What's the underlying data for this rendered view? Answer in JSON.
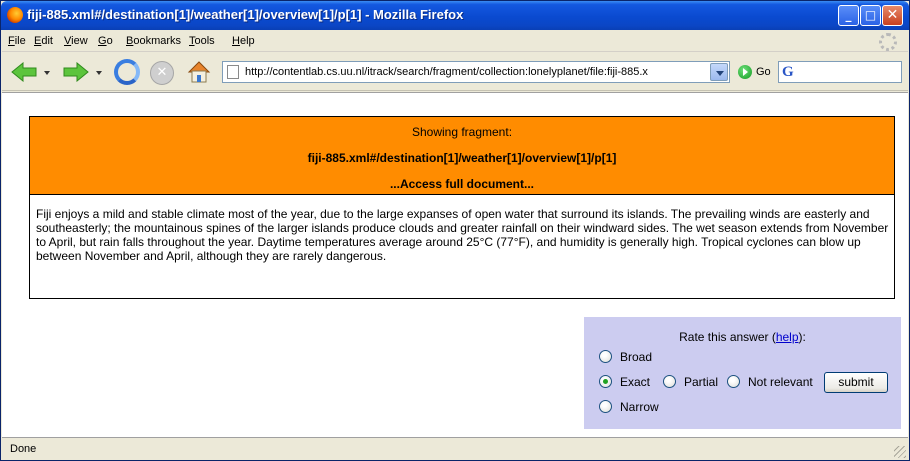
{
  "window": {
    "title": "fiji-885.xml#/destination[1]/weather[1]/overview[1]/p[1] - Mozilla Firefox",
    "controls": {
      "minimize": "_",
      "maximize": "□",
      "close": "✕"
    }
  },
  "menu": {
    "file": {
      "u": "F",
      "rest": "ile"
    },
    "edit": {
      "u": "E",
      "rest": "dit"
    },
    "view": {
      "u": "V",
      "rest": "iew"
    },
    "go": {
      "u": "G",
      "rest": "o"
    },
    "bookmarks": {
      "u": "B",
      "rest": "ookmarks"
    },
    "tools": {
      "u": "T",
      "rest": "ools"
    },
    "help": {
      "u": "H",
      "rest": "elp"
    }
  },
  "toolbar": {
    "url": "http://contentlab.cs.uu.nl/itrack/search/fragment/collection:lonelyplanet/file:fiji-885.x",
    "go_label": "Go",
    "search_logo": "G",
    "stop_symbol": "✕"
  },
  "fragment": {
    "showing_label": "Showing fragment:",
    "id": "fiji-885.xml#/destination[1]/weather[1]/overview[1]/p[1]",
    "access_link": "...Access full document...",
    "text": "Fiji enjoys a mild and stable climate most of the year, due to the large expanses of open water that surround its islands. The prevailing winds are easterly and southeasterly; the mountainous spines of the larger islands produce clouds and greater rainfall on their windward sides. The wet season extends from November to April, but rain falls throughout the year. Daytime temperatures average around 25°C (77°F), and humidity is generally high. Tropical cyclones can blow up between November and April, although they are rarely dangerous."
  },
  "rating": {
    "title_prefix": "Rate this answer (",
    "help_link": "help",
    "title_suffix": "):",
    "options": {
      "broad": "Broad",
      "exact": "Exact",
      "partial": "Partial",
      "not_relevant": "Not relevant",
      "narrow": "Narrow"
    },
    "selected": "Exact",
    "submit_label": "submit"
  },
  "status": {
    "text": "Done"
  },
  "colors": {
    "fragment_header_bg": "#ff8c00",
    "rating_panel_bg": "#ccccf0",
    "titlebar_blue": "#0a4ad0"
  }
}
